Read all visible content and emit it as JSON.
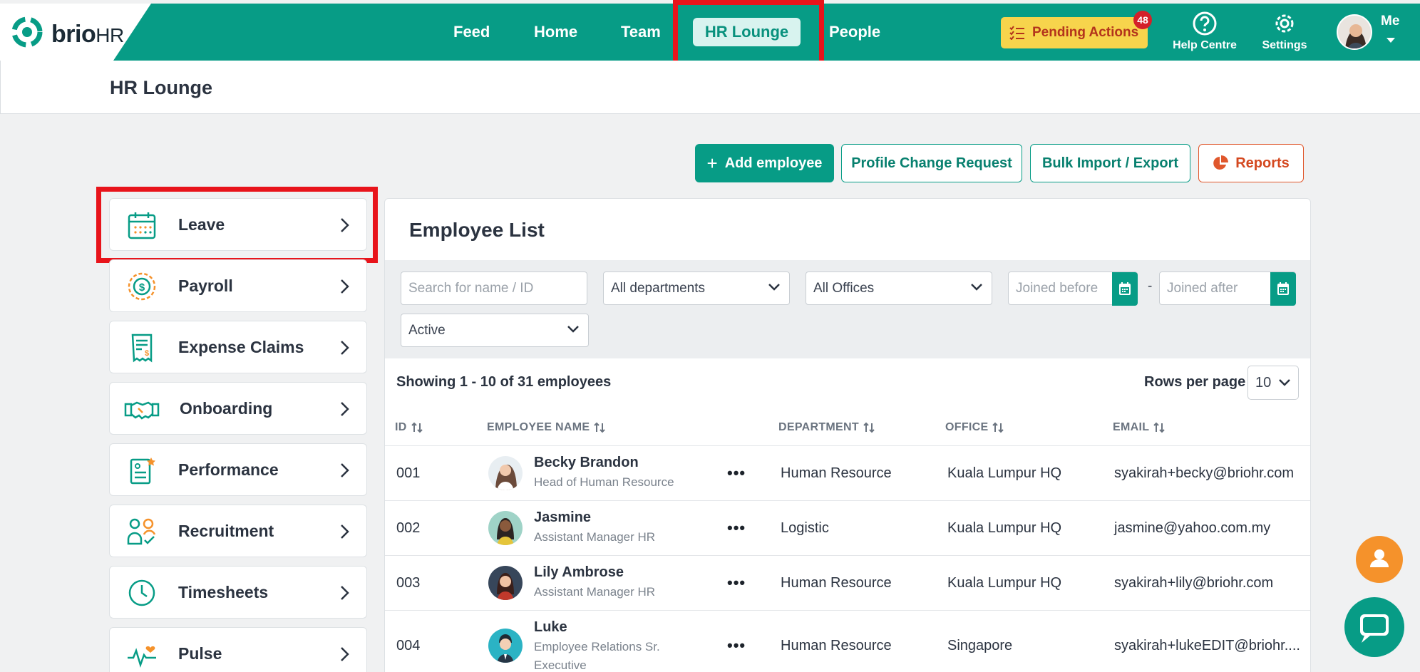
{
  "brand": {
    "name_a": "brio",
    "name_b": "HR"
  },
  "nav": {
    "items": [
      {
        "label": "Feed"
      },
      {
        "label": "Home"
      },
      {
        "label": "Team"
      },
      {
        "label": "HR Lounge",
        "active": true
      },
      {
        "label": "People"
      }
    ]
  },
  "topbar": {
    "pending_label": "Pending Actions",
    "pending_count": "48",
    "help_label": "Help Centre",
    "settings_label": "Settings",
    "me_label": "Me"
  },
  "page": {
    "title": "HR Lounge"
  },
  "actions": {
    "add_employee": "Add employee",
    "add_plus": "+",
    "profile_change": "Profile Change Request",
    "bulk": "Bulk Import / Export",
    "reports": "Reports"
  },
  "menu": {
    "items": [
      {
        "label": "Leave",
        "icon": "calendar-icon"
      },
      {
        "label": "Payroll",
        "icon": "payroll-coin-icon"
      },
      {
        "label": "Expense Claims",
        "icon": "receipt-icon"
      },
      {
        "label": "Onboarding",
        "icon": "handshake-icon"
      },
      {
        "label": "Performance",
        "icon": "performance-clipboard-icon"
      },
      {
        "label": "Recruitment",
        "icon": "recruitment-people-icon"
      },
      {
        "label": "Timesheets",
        "icon": "clock-icon"
      },
      {
        "label": "Pulse",
        "icon": "pulse-heart-icon"
      }
    ]
  },
  "employees": {
    "title": "Employee List",
    "search_placeholder": "Search for name / ID",
    "department_value": "All departments",
    "office_value": "All Offices",
    "joined_before_placeholder": "Joined before",
    "joined_after_placeholder": "Joined after",
    "date_separator": "-",
    "status_value": "Active",
    "showing": "Showing 1 - 10 of 31 employees",
    "rows_per_page_label": "Rows per page",
    "rows_per_page_value": "10",
    "columns": {
      "id": "ID",
      "name": "EMPLOYEE NAME",
      "department": "DEPARTMENT",
      "office": "OFFICE",
      "email": "EMAIL"
    },
    "rows": [
      {
        "id": "001",
        "name": "Becky Brandon",
        "title": "Head of Human Resource",
        "department": "Human Resource",
        "office": "Kuala Lumpur HQ",
        "email": "syakirah+becky@briohr.com",
        "more": "•••"
      },
      {
        "id": "002",
        "name": "Jasmine",
        "title": "Assistant Manager HR",
        "department": "Logistic",
        "office": "Kuala Lumpur HQ",
        "email": "jasmine@yahoo.com.my",
        "more": "•••"
      },
      {
        "id": "003",
        "name": "Lily Ambrose",
        "title": "Assistant Manager HR",
        "department": "Human Resource",
        "office": "Kuala Lumpur HQ",
        "email": "syakirah+lily@briohr.com",
        "more": "•••"
      },
      {
        "id": "004",
        "name": "Luke",
        "title": "Employee Relations Sr. Executive",
        "department": "Human Resource",
        "office": "Singapore",
        "email": "syakirah+lukeEDIT@briohr....",
        "more": "•••"
      }
    ]
  },
  "colors": {
    "brand": "#079c86",
    "pending": "#f7d44c",
    "highlight": "#e8141b",
    "reports": "#e0572c",
    "fab_person": "#f5922b"
  }
}
